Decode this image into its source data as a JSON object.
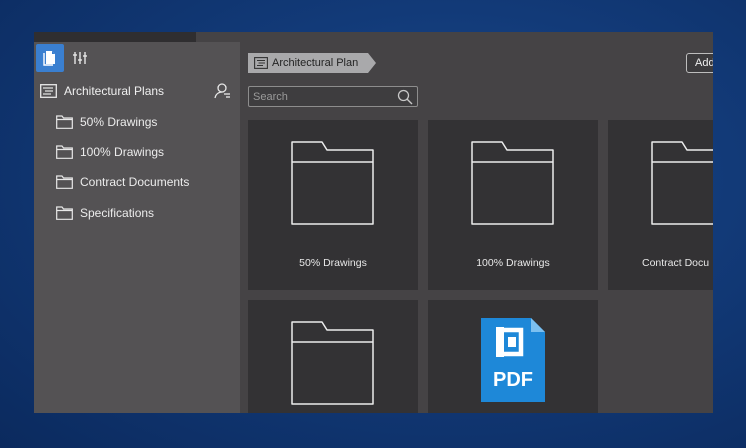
{
  "sidebar": {
    "root_label": "Architectural Plans",
    "items": [
      {
        "label": "50% Drawings"
      },
      {
        "label": "100% Drawings"
      },
      {
        "label": "Contract Documents"
      },
      {
        "label": "Specifications"
      }
    ]
  },
  "main": {
    "breadcrumb": "Architectural Plan",
    "add_button": "Add",
    "search": {
      "placeholder": "Search"
    },
    "tiles": [
      {
        "label": "50% Drawings"
      },
      {
        "label": "100% Drawings"
      },
      {
        "label": "Contract Docu"
      },
      {
        "label": ""
      },
      {
        "label": "PDF"
      }
    ]
  },
  "icons": {
    "documents_tool": "document-icon",
    "filters_tool": "sliders-icon",
    "root": "list-icon",
    "user_search": "user-search-icon",
    "folder": "folder-icon",
    "search": "search-icon",
    "pdf": "pdf-file-icon"
  },
  "colors": {
    "accent_blue": "#3a7fd0",
    "pdf_blue": "#1e88d8",
    "panel_bg": "#545254",
    "main_bg": "#454345",
    "tile_bg": "#333234"
  }
}
